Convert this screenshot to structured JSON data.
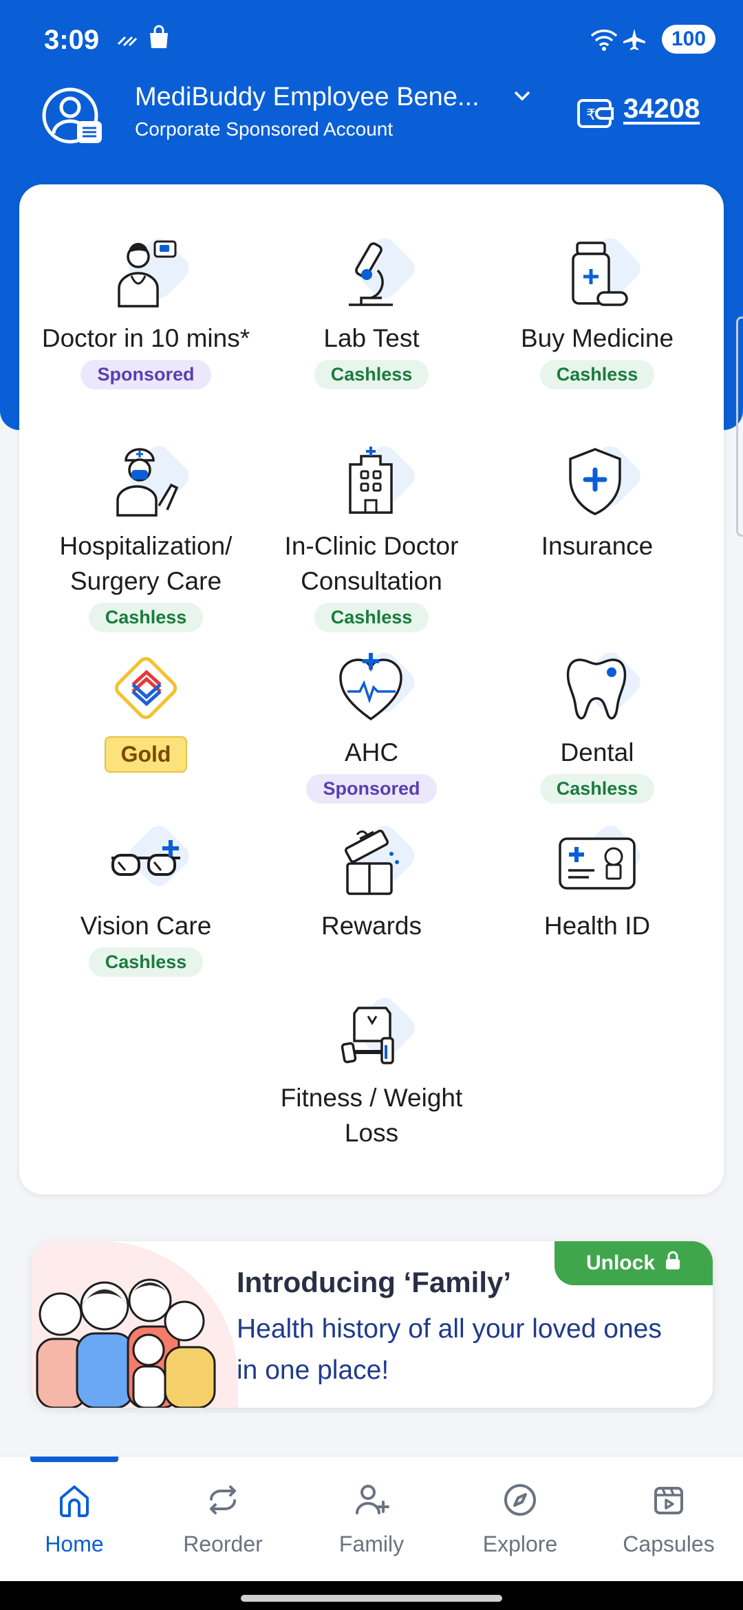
{
  "status_bar": {
    "time": "3:09",
    "battery": "100"
  },
  "header": {
    "account_name": "MediBuddy Employee Bene...",
    "account_type": "Corporate Sponsored Account",
    "wallet_balance": "34208"
  },
  "services": [
    {
      "label": "Doctor in 10 mins*",
      "badge": "Sponsored",
      "icon": "doctor-icon"
    },
    {
      "label": "Lab Test",
      "badge": "Cashless",
      "icon": "microscope-icon"
    },
    {
      "label": "Buy Medicine",
      "badge": "Cashless",
      "icon": "medicine-icon"
    },
    {
      "label": "Hospitalization/ Surgery Care",
      "badge": "Cashless",
      "icon": "surgeon-icon"
    },
    {
      "label": "In-Clinic Doctor Consultation",
      "badge": "Cashless",
      "icon": "hospital-icon"
    },
    {
      "label": "Insurance",
      "badge": "",
      "icon": "shield-icon"
    },
    {
      "label": "",
      "badge": "Gold",
      "icon": "gold-logo-icon"
    },
    {
      "label": "AHC",
      "badge": "Sponsored",
      "icon": "heart-icon"
    },
    {
      "label": "Dental",
      "badge": "Cashless",
      "icon": "tooth-icon"
    },
    {
      "label": "Vision Care",
      "badge": "Cashless",
      "icon": "glasses-icon"
    },
    {
      "label": "Rewards",
      "badge": "",
      "icon": "gift-icon"
    },
    {
      "label": "Health ID",
      "badge": "",
      "icon": "id-card-icon"
    },
    {
      "label": "Fitness / Weight Loss",
      "badge": "",
      "icon": "dumbbell-icon"
    }
  ],
  "family_banner": {
    "unlock_label": "Unlock",
    "title": "Introducing ‘Family’",
    "description": "Health history of all your loved ones in one place!"
  },
  "bottom_nav": [
    {
      "label": "Home",
      "icon": "home-icon",
      "active": true
    },
    {
      "label": "Reorder",
      "icon": "reorder-icon",
      "active": false
    },
    {
      "label": "Family",
      "icon": "add-person-icon",
      "active": false
    },
    {
      "label": "Explore",
      "icon": "compass-icon",
      "active": false
    },
    {
      "label": "Capsules",
      "icon": "video-icon",
      "active": false
    }
  ],
  "colors": {
    "brand_blue": "#0a5fd6",
    "cashless_green": "#1a7b3e",
    "sponsored_purple": "#5a3fb0",
    "unlock_green": "#3fa64c"
  }
}
